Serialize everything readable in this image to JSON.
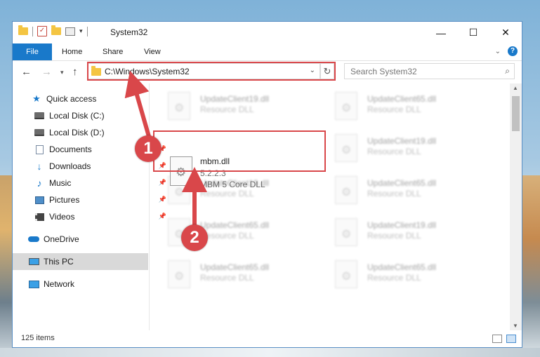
{
  "window": {
    "title": "System32",
    "controls": {
      "minimize": "—",
      "maximize": "☐",
      "close": "✕"
    }
  },
  "ribbon": {
    "tabs": [
      "File",
      "Home",
      "Share",
      "View"
    ],
    "help": "?"
  },
  "navigation": {
    "address": "C:\\Windows\\System32",
    "search_placeholder": "Search System32"
  },
  "sidebar": {
    "items": [
      {
        "label": "Quick access",
        "icon": "star-icon"
      },
      {
        "label": "Local Disk (C:)",
        "icon": "disk-icon"
      },
      {
        "label": "Local Disk (D:)",
        "icon": "disk-icon"
      },
      {
        "label": "Documents",
        "icon": "document-icon"
      },
      {
        "label": "Downloads",
        "icon": "download-icon"
      },
      {
        "label": "Music",
        "icon": "music-icon"
      },
      {
        "label": "Pictures",
        "icon": "pictures-icon"
      },
      {
        "label": "Videos",
        "icon": "videos-icon"
      },
      {
        "label": "OneDrive",
        "icon": "cloud-icon"
      },
      {
        "label": "This PC",
        "icon": "computer-icon",
        "selected": true
      },
      {
        "label": "Network",
        "icon": "network-icon"
      }
    ]
  },
  "files": {
    "background": [
      {
        "name": "UpdateClient19.dll",
        "desc": "Resource DLL"
      },
      {
        "name": "UpdateClient65.dll",
        "desc": "Resource DLL"
      },
      {
        "name": "UpdateClient19.dll",
        "desc": "Resource DLL"
      },
      {
        "name": "UpdateClient19.dll",
        "desc": "Resource DLL"
      },
      {
        "name": "UpdateClient65.dll",
        "desc": "Resource DLL"
      },
      {
        "name": "UpdateClient65.dll",
        "desc": "Resource DLL"
      },
      {
        "name": "UpdateClient19.dll",
        "desc": "Resource DLL"
      },
      {
        "name": "UpdateClient65.dll",
        "desc": "Resource DLL"
      },
      {
        "name": "UpdateClient65.dll",
        "desc": "Resource DLL"
      }
    ],
    "selected": {
      "name": "mbm.dll",
      "version": "5.2.2.3",
      "description": "MBM 5 Core DLL"
    }
  },
  "status": {
    "item_count": "125 items"
  },
  "annotations": {
    "step1": "1",
    "step2": "2",
    "color": "#d9474a"
  }
}
